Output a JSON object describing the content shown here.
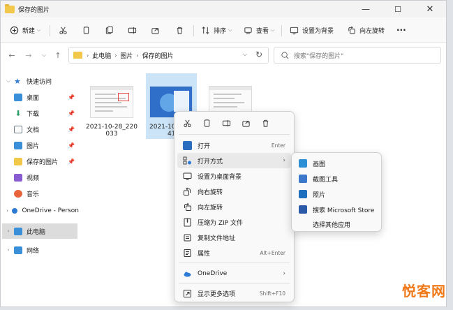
{
  "window": {
    "title": "保存的图片",
    "controls": {
      "minimize": "—",
      "maximize": "☐",
      "close": "✕"
    }
  },
  "toolbar": {
    "new_label": "新建",
    "sort_label": "排序",
    "view_label": "查看",
    "set_bg_label": "设置为背景",
    "rotate_left_label": "向左旋转",
    "more_label": "···"
  },
  "address": {
    "crumbs": [
      "此电脑",
      "图片",
      "保存的图片"
    ],
    "search_placeholder": "搜索\"保存的图片\""
  },
  "sidebar": {
    "items": [
      {
        "label": "快速访问",
        "icon": "star-icon",
        "color": "#f2c84b"
      },
      {
        "label": "桌面",
        "icon": "desktop-icon",
        "color": "#3a8fd9"
      },
      {
        "label": "下载",
        "icon": "download-icon",
        "color": "#2f9e6a"
      },
      {
        "label": "文档",
        "icon": "document-icon",
        "color": "#6f7c8a"
      },
      {
        "label": "图片",
        "icon": "picture-icon",
        "color": "#3a8fd9"
      },
      {
        "label": "保存的图片",
        "icon": "folder-icon",
        "color": "#f2c84b"
      },
      {
        "label": "视频",
        "icon": "video-icon",
        "color": "#8a5cd1"
      },
      {
        "label": "音乐",
        "icon": "music-icon",
        "color": "#e8623a"
      },
      {
        "label": "OneDrive - Person",
        "icon": "cloud-icon",
        "color": "#2e7bd6"
      },
      {
        "label": "此电脑",
        "icon": "computer-icon",
        "color": "#3a8fd9"
      },
      {
        "label": "网络",
        "icon": "network-icon",
        "color": "#3a8fd9"
      }
    ]
  },
  "files": [
    {
      "name_line1": "2021-10-28_220",
      "name_line2": "033"
    },
    {
      "name_line1": "2021-10-",
      "name_line2": "412"
    },
    {
      "name_line1": "",
      "name_line2": ""
    }
  ],
  "context_menu": {
    "items": [
      {
        "label": "打开",
        "hint": "Enter",
        "icon": "image-open-icon"
      },
      {
        "label": "打开方式",
        "hint": "›",
        "icon": "open-with-icon"
      },
      {
        "label": "设置为桌面背景",
        "hint": "",
        "icon": "wallpaper-icon"
      },
      {
        "label": "向右旋转",
        "hint": "",
        "icon": "rotate-right-icon"
      },
      {
        "label": "向左旋转",
        "hint": "",
        "icon": "rotate-left-icon"
      },
      {
        "label": "压缩为 ZIP 文件",
        "hint": "",
        "icon": "zip-icon"
      },
      {
        "label": "复制文件地址",
        "hint": "",
        "icon": "copy-path-icon"
      },
      {
        "label": "属性",
        "hint": "Alt+Enter",
        "icon": "properties-icon"
      },
      {
        "label": "OneDrive",
        "hint": "›",
        "icon": "onedrive-icon"
      },
      {
        "label": "显示更多选项",
        "hint": "Shift+F10",
        "icon": "more-options-icon"
      }
    ]
  },
  "submenu": {
    "items": [
      {
        "label": "画图",
        "color": "#2d8fd5"
      },
      {
        "label": "截图工具",
        "color": "#3b78c9"
      },
      {
        "label": "照片",
        "color": "#1f6fbf"
      },
      {
        "label": "搜索 Microsoft Store",
        "color": "#2b5aa8"
      },
      {
        "label": "选择其他应用",
        "color": ""
      }
    ]
  },
  "watermark": "悦客网"
}
